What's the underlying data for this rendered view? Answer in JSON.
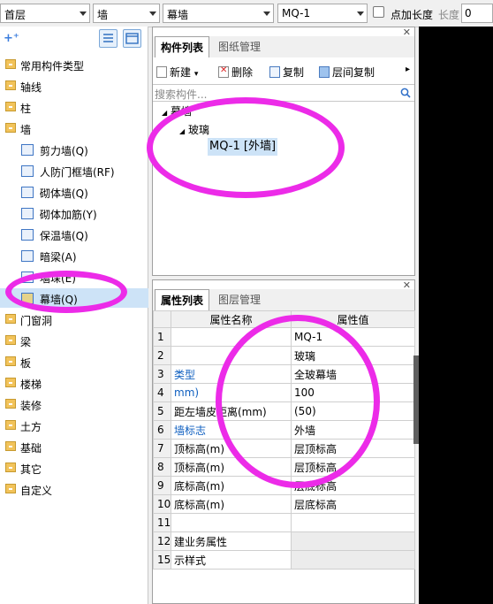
{
  "toolbar": {
    "floor": "首层",
    "category": "墙",
    "type": "幕墙",
    "component": "MQ-1",
    "point_length_label": "点加长度",
    "length_label": "长度",
    "length_value": "0"
  },
  "leftnav": {
    "items": [
      {
        "label": "常用构件类型"
      },
      {
        "label": "轴线"
      },
      {
        "label": "柱"
      },
      {
        "label": "墙"
      },
      {
        "label": "剪力墙(Q)"
      },
      {
        "label": "人防门框墙(RF)"
      },
      {
        "label": "砌体墙(Q)"
      },
      {
        "label": "砌体加筋(Y)"
      },
      {
        "label": "保温墙(Q)"
      },
      {
        "label": "暗梁(A)"
      },
      {
        "label": "墙垛(E)"
      },
      {
        "label": "幕墙(Q)"
      },
      {
        "label": "门窗洞"
      },
      {
        "label": "梁"
      },
      {
        "label": "板"
      },
      {
        "label": "楼梯"
      },
      {
        "label": "装修"
      },
      {
        "label": "土方"
      },
      {
        "label": "基础"
      },
      {
        "label": "其它"
      },
      {
        "label": "自定义"
      }
    ]
  },
  "component_panel": {
    "tabs": [
      "构件列表",
      "图纸管理"
    ],
    "actions": {
      "new": "新建",
      "delete": "删除",
      "copy": "复制",
      "floor_copy": "层间复制"
    },
    "search_placeholder": "搜索构件...",
    "tree": {
      "root": "幕墙",
      "child": "玻璃",
      "leaf": "MQ-1 [外墙]"
    }
  },
  "property_panel": {
    "tabs": [
      "属性列表",
      "图层管理"
    ],
    "headers": {
      "name": "属性名称",
      "value": "属性值"
    },
    "rows": [
      {
        "num": "1",
        "name": "",
        "value": "MQ-1"
      },
      {
        "num": "2",
        "name": "",
        "value": "玻璃"
      },
      {
        "num": "3",
        "name": "类型",
        "value": "全玻幕墙"
      },
      {
        "num": "4",
        "name": "mm)",
        "value": "100"
      },
      {
        "num": "5",
        "name": "距左墙皮距离(mm)",
        "value": "(50)"
      },
      {
        "num": "6",
        "name": "墙标志",
        "value": "外墙"
      },
      {
        "num": "7",
        "name": "顶标高(m)",
        "value": "层顶标高"
      },
      {
        "num": "8",
        "name": "顶标高(m)",
        "value": "层顶标高"
      },
      {
        "num": "9",
        "name": "底标高(m)",
        "value": "层底标高"
      },
      {
        "num": "10",
        "name": "底标高(m)",
        "value": "层底标高"
      },
      {
        "num": "11",
        "name": "",
        "value": ""
      },
      {
        "num": "12",
        "name": "建业务属性",
        "value": ""
      },
      {
        "num": "15",
        "name": "示样式",
        "value": ""
      }
    ]
  },
  "colors": {
    "annotation": "#ec2be8",
    "selection": "#cde3f7",
    "link": "#1060c0"
  }
}
